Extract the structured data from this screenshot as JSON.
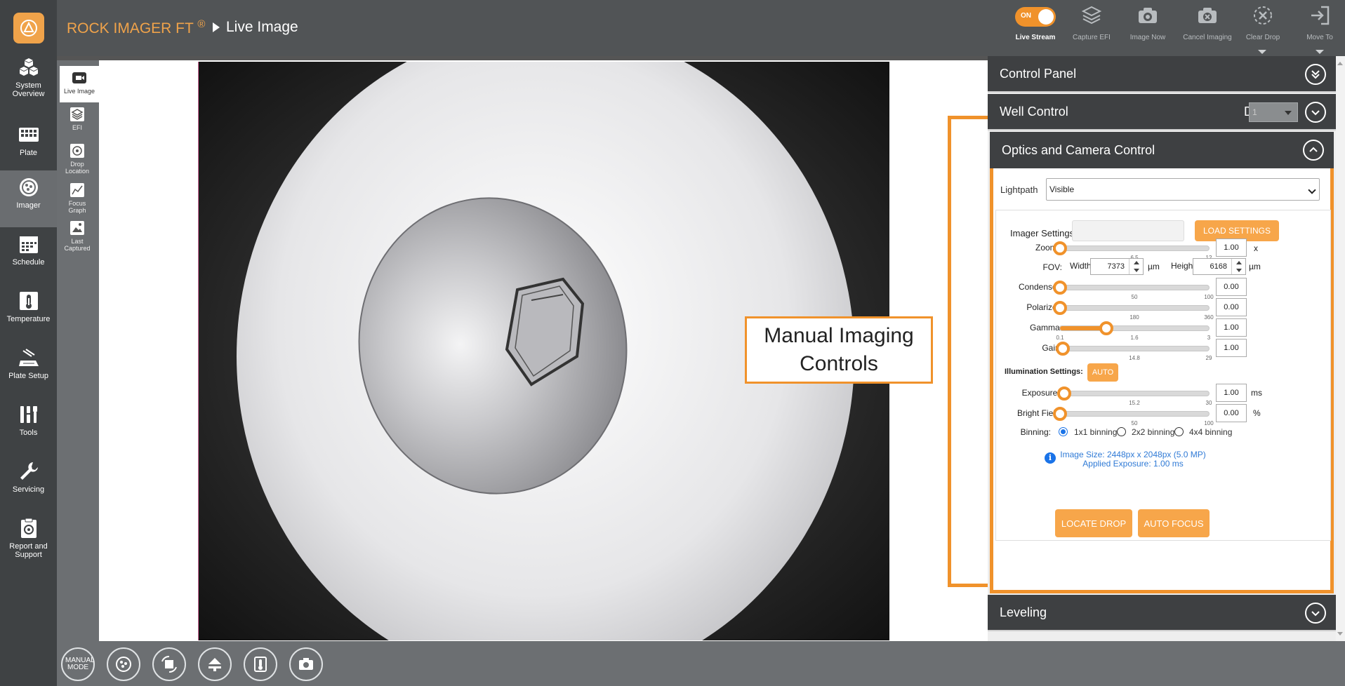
{
  "app": {
    "title": "ROCK IMAGER FT",
    "trademark": "®",
    "breadcrumb": "Live Image"
  },
  "leftnav": [
    {
      "label": "System Overview",
      "icon": "cubes-icon"
    },
    {
      "label": "Plate",
      "icon": "plate-grid-icon"
    },
    {
      "label": "Imager",
      "icon": "imager-icon"
    },
    {
      "label": "Schedule",
      "icon": "calendar-icon"
    },
    {
      "label": "Temperature",
      "icon": "thermometer-icon"
    },
    {
      "label": "Plate Setup",
      "icon": "plate-setup-icon"
    },
    {
      "label": "Tools",
      "icon": "tools-icon"
    },
    {
      "label": "Servicing",
      "icon": "wrench-icon"
    },
    {
      "label": "Report and Support",
      "icon": "report-icon"
    }
  ],
  "toolbar": {
    "live_stream": {
      "label": "Live Stream",
      "toggle": "ON"
    },
    "capture_efi": "Capture EFI",
    "image_now": "Image Now",
    "cancel_imaging": "Cancel Imaging",
    "clear_drop": "Clear Drop",
    "move_to": "Move To"
  },
  "viewtabs": [
    {
      "label": "Live Image",
      "icon": "camera-icon"
    },
    {
      "label": "EFI",
      "icon": "layers-icon"
    },
    {
      "label": "Drop Location",
      "icon": "target-icon"
    },
    {
      "label": "Focus Graph",
      "icon": "graph-icon"
    },
    {
      "label": "Last Captured",
      "icon": "photo-icon"
    }
  ],
  "callout": {
    "line1": "Manual Imaging",
    "line2": "Controls"
  },
  "bottombar": {
    "manual_mode": "MANUAL MODE"
  },
  "panel": {
    "control_panel": "Control Panel",
    "well_control": "Well Control",
    "drop_label": "Drop",
    "drop_value": "1",
    "optics_title": "Optics and Camera Control",
    "lightpath_label": "Lightpath",
    "lightpath_value": "Visible",
    "imager_settings_label": "Imager Settings",
    "load_settings": "LOAD SETTINGS",
    "zoom": {
      "label": "Zoom:",
      "value": "1.00",
      "unit": "x",
      "ticks": [
        "6.5",
        "12"
      ],
      "level": 0.0
    },
    "fov": {
      "label": "FOV:",
      "width_label": "Width",
      "width_value": "7373",
      "width_unit": "µm",
      "height_label": "Height",
      "height_value": "6168",
      "height_unit": "µm"
    },
    "condenser": {
      "label": "Condenser:",
      "value": "0.00",
      "ticks": [
        "50",
        "100"
      ],
      "level": 0.0
    },
    "polarizer": {
      "label": "Polarizer:",
      "value": "0.00",
      "ticks": [
        "180",
        "360"
      ],
      "level": 0.0
    },
    "gamma": {
      "label": "Gamma:",
      "value": "1.00",
      "ticks": [
        "0.1",
        "1.6",
        "3"
      ],
      "level": 0.31
    },
    "gain": {
      "label": "Gain:",
      "value": "1.00",
      "ticks": [
        "14.8",
        "29"
      ],
      "level": 0.02
    },
    "illumination_label": "Illumination Settings:",
    "auto": "AUTO",
    "exposure": {
      "label": "Exposure :",
      "value": "1.00",
      "unit": "ms",
      "ticks": [
        "15.2",
        "30"
      ],
      "level": 0.03
    },
    "brightfield": {
      "label": "Bright Field:",
      "value": "0.00",
      "unit": "%",
      "ticks": [
        "50",
        "100"
      ],
      "level": 0.0
    },
    "binning_label": "Binning:",
    "binning_options": [
      "1x1 binning",
      "2x2 binning",
      "4x4 binning"
    ],
    "binning_selected": "1x1 binning",
    "image_size": "Image Size: 2448px x 2048px (5.0 MP)",
    "applied_exposure": "Applied Exposure: 1.00 ms",
    "locate_drop": "LOCATE DROP",
    "auto_focus": "AUTO FOCUS",
    "leveling": "Leveling"
  },
  "colors": {
    "accent": "#f0922b",
    "header": "#515456",
    "nav": "#3f4244",
    "link": "#2f7ad6"
  }
}
